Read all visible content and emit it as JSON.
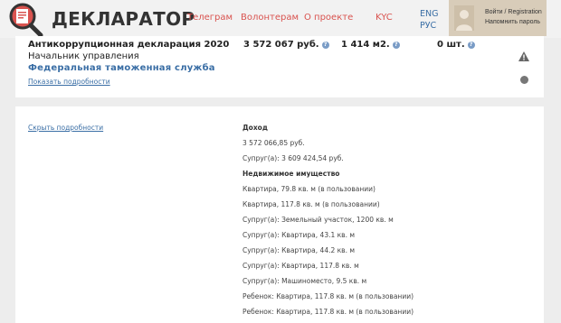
{
  "header": {
    "logo_text": "ДЕКЛАРАТОР",
    "nav": [
      "Телеграм",
      "Волонтерам",
      "О проекте",
      "KYC"
    ],
    "lang": {
      "en": "ENG",
      "ru": "РУС"
    },
    "login": {
      "line1": "Войти / Registration",
      "line2": "Напомнить пароль"
    },
    "icons": [
      "logo-icon",
      "avatar-icon"
    ]
  },
  "summary": {
    "title": "Антикоррупционная декларация 2020",
    "position": "Начальник управления",
    "agency": "Федеральная таможенная служба",
    "show_details": "Показать подробности",
    "income": "3 572 067 руб.",
    "area": "1 414 м2.",
    "vehicles": "0 шт.",
    "help_icon": "?",
    "icons": [
      "question-icon",
      "warning-icon",
      "dot-icon"
    ]
  },
  "details": {
    "hide_details": "Скрыть подробности",
    "income_heading": "Доход",
    "income_items": [
      "3 572 066,85 руб.",
      "Супруг(а): 3 609 424,54 руб."
    ],
    "realty_heading": "Недвижимое имущество",
    "realty_items": [
      "Квартира, 79.8 кв. м (в пользовании)",
      "Квартира, 117.8 кв. м (в пользовании)",
      "Супруг(а): Земельный участок, 1200 кв. м",
      "Супруг(а): Квартира, 43.1 кв. м",
      "Супруг(а): Квартира, 44.2 кв. м",
      "Супруг(а): Квартира, 117.8 кв. м",
      "Супруг(а): Машиноместо, 9.5 кв. м",
      "Ребенок: Квартира, 117.8 кв. м (в пользовании)",
      "Ребенок: Квартира, 117.8 кв. м (в пользовании)"
    ]
  },
  "colors": {
    "nav": "#d9534f",
    "link": "#3a6ea5",
    "user_box": "#d8ccb9",
    "background": "#ededed"
  }
}
